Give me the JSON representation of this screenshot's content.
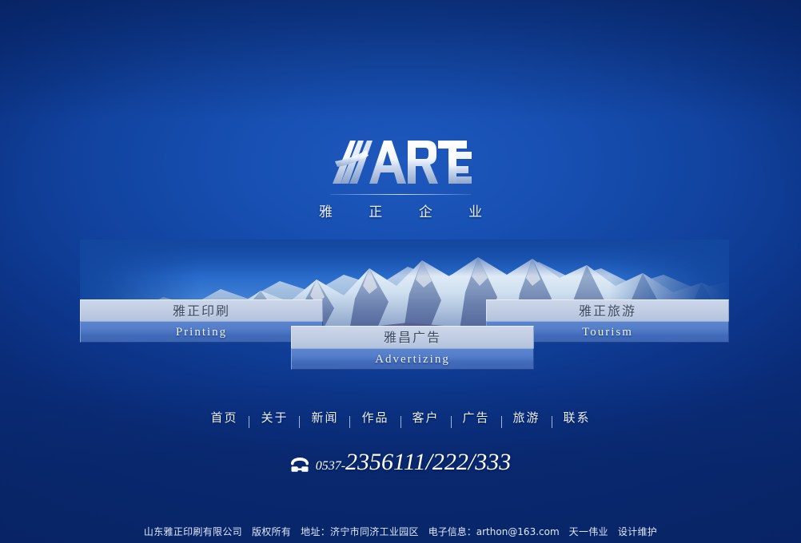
{
  "site": {
    "logo_wordmark": "ART",
    "logo_sub": "雅 正 企 业",
    "logo_icon": "art-zheng-logotype"
  },
  "sections": [
    {
      "id": "printing",
      "cn": "雅正印刷",
      "en": "Printing"
    },
    {
      "id": "advert",
      "cn": "雅昌广告",
      "en": "Advertizing"
    },
    {
      "id": "tourism",
      "cn": "雅正旅游",
      "en": "Tourism"
    }
  ],
  "nav": {
    "items": [
      {
        "label": "首页"
      },
      {
        "label": "关于"
      },
      {
        "label": "新闻"
      },
      {
        "label": "作品"
      },
      {
        "label": "客户"
      },
      {
        "label": "广告"
      },
      {
        "label": "旅游"
      },
      {
        "label": "联系"
      }
    ]
  },
  "contact": {
    "icon": "telephone-icon",
    "area_code": "0537-",
    "number": "2356111/222/333"
  },
  "footer": {
    "company": "山东雅正印刷有限公司",
    "copyright": "版权所有",
    "address": "地址：济宁市同济工业园区",
    "email": "电子信息：arthon@163.com",
    "designer": "天一伟业",
    "designer_role": "设计维护"
  },
  "colors": {
    "background_blue": "#11429e",
    "background_blue_light": "#1f58bd",
    "background_blue_dark": "#0a2c79",
    "button_top": "#c2cee4",
    "button_bottom": "#4069b8",
    "text_light": "#e9effb"
  }
}
